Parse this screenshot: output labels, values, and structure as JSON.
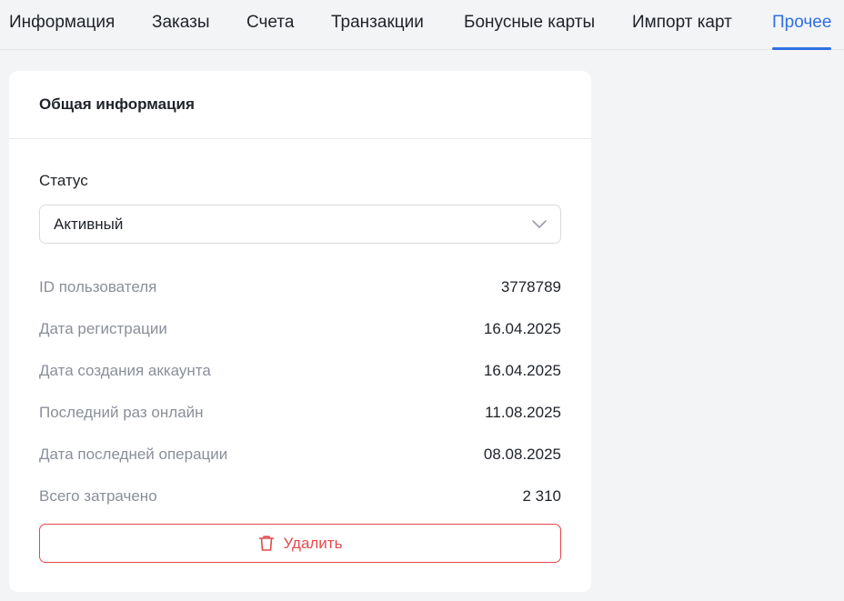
{
  "tabs": [
    {
      "label": "Информация"
    },
    {
      "label": "Заказы"
    },
    {
      "label": "Счета"
    },
    {
      "label": "Транзакции"
    },
    {
      "label": "Бонусные карты"
    },
    {
      "label": "Импорт карт"
    },
    {
      "label": "Прочее",
      "active": true
    }
  ],
  "card": {
    "title": "Общая информация",
    "status": {
      "label": "Статус",
      "value": "Активный"
    },
    "rows": [
      {
        "label": "ID пользователя",
        "value": "3778789"
      },
      {
        "label": "Дата регистрации",
        "value": "16.04.2025"
      },
      {
        "label": "Дата создания аккаунта",
        "value": "16.04.2025"
      },
      {
        "label": "Последний раз онлайн",
        "value": "11.08.2025"
      },
      {
        "label": "Дата последней операции",
        "value": "08.08.2025"
      },
      {
        "label": "Всего затрачено",
        "value": "2 310"
      }
    ],
    "delete_label": "Удалить"
  },
  "icons": {
    "select": "chevron-down-icon",
    "delete": "trash-icon"
  },
  "colors": {
    "accent": "#2f6fe4",
    "danger": "#e5484d",
    "muted_text": "#8a8f98"
  }
}
